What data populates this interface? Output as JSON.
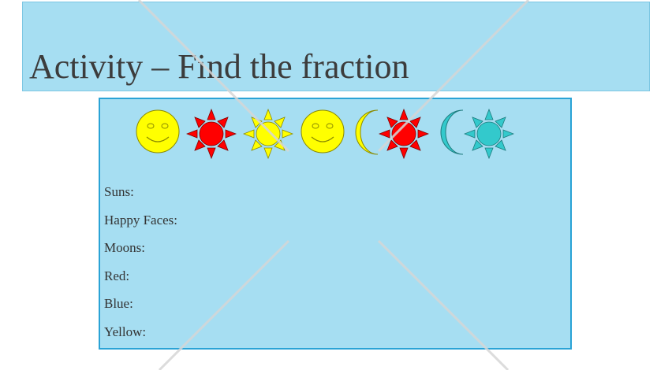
{
  "title": "Activity – Find the fraction",
  "colors": {
    "title_background": "#a6def2",
    "content_background": "#a6def2",
    "content_border": "#2aa3d6",
    "yellow": "#ffff00",
    "red": "#ff0000",
    "teal": "#33c9cc"
  },
  "shapes": [
    {
      "type": "smiley-face-icon",
      "color": "yellow"
    },
    {
      "type": "sun-icon",
      "color": "red"
    },
    {
      "type": "sun-icon",
      "color": "yellow"
    },
    {
      "type": "smiley-face-icon",
      "color": "yellow"
    },
    {
      "type": "moon-icon",
      "color": "yellow"
    },
    {
      "type": "sun-icon",
      "color": "red"
    },
    {
      "type": "moon-icon",
      "color": "teal"
    },
    {
      "type": "sun-icon",
      "color": "teal"
    }
  ],
  "questions": [
    {
      "label": "Suns:"
    },
    {
      "label": "Happy Faces:"
    },
    {
      "label": "Moons:"
    },
    {
      "label": "Red:"
    },
    {
      "label": "Blue:"
    },
    {
      "label": "Yellow:"
    }
  ]
}
